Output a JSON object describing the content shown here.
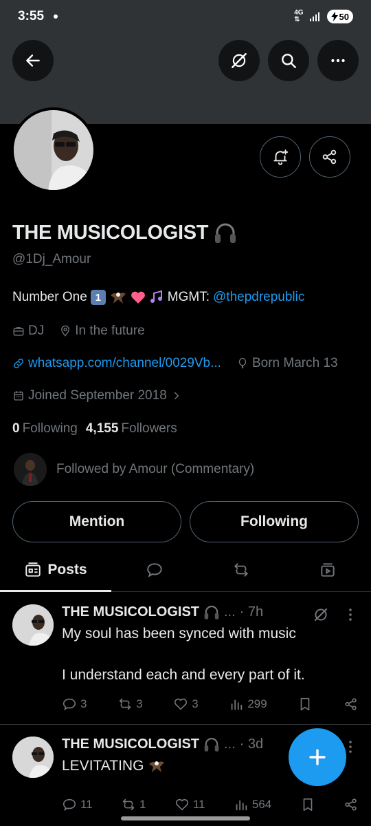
{
  "status_bar": {
    "time": "3:55",
    "network": "4G",
    "battery": "50"
  },
  "profile": {
    "name": "THE MUSICOLOGIST",
    "handle": "@1Dj_Amour",
    "bio_prefix": "Number One",
    "bio_keycap": "1",
    "bio_mgmt": "MGMT:",
    "bio_link": "@thepdrepublic",
    "category": "DJ",
    "location": "In the future",
    "website": "whatsapp.com/channel/0029Vb...",
    "birthday": "Born March 13",
    "joined": "Joined September 2018",
    "following_count": "0",
    "following_label": "Following",
    "followers_count": "4,155",
    "followers_label": "Followers",
    "followed_by": "Followed by Amour (Commentary)"
  },
  "buttons": {
    "mention": "Mention",
    "following": "Following"
  },
  "tabs": [
    {
      "label": "Posts",
      "icon": "posts-icon",
      "active": true
    },
    {
      "label": "",
      "icon": "reply-icon",
      "active": false
    },
    {
      "label": "",
      "icon": "repost-icon",
      "active": false
    },
    {
      "label": "",
      "icon": "media-icon",
      "active": false
    }
  ],
  "tweets": [
    {
      "name": "THE MUSICOLOGIST",
      "truncation": "...",
      "time": "· 7h",
      "text": "My soul has been synced with music\n\nI understand each and every part of it.",
      "replies": "3",
      "reposts": "3",
      "likes": "3",
      "views": "299"
    },
    {
      "name": "THE MUSICOLOGIST",
      "truncation": "...",
      "time": "· 3d",
      "text": "LEVITATING",
      "replies": "11",
      "reposts": "1",
      "likes": "11",
      "views": "564"
    }
  ],
  "colors": {
    "accent": "#1d9bf0",
    "background": "#000000",
    "secondary_text": "#71767b",
    "banner": "#2f3336"
  }
}
